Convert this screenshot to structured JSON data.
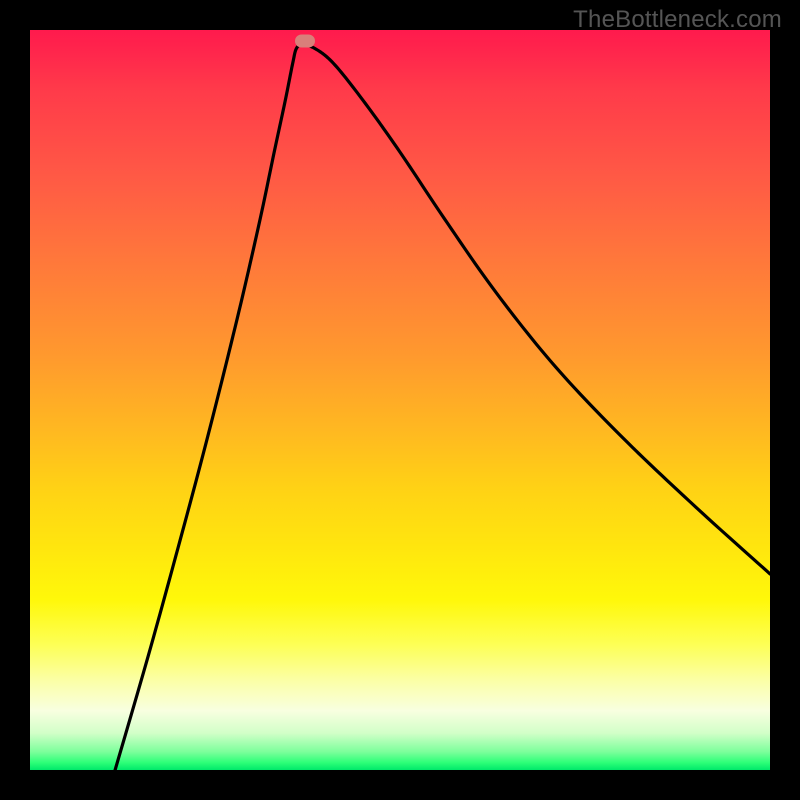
{
  "watermark": "TheBottleneck.com",
  "colors": {
    "curve_stroke": "#000000",
    "marker_fill": "#d97f7a",
    "frame_bg": "#000000"
  },
  "chart_data": {
    "type": "line",
    "title": "",
    "xlabel": "",
    "ylabel": "",
    "xlim": [
      0,
      1
    ],
    "ylim": [
      0,
      1
    ],
    "trough_x": 0.368,
    "trough_y": 0.98,
    "left_start_x": 0.115,
    "right_end_y": 0.265,
    "series": [
      {
        "name": "bottleneck-curve",
        "x": [
          0.115,
          0.16,
          0.2,
          0.24,
          0.28,
          0.31,
          0.33,
          0.345,
          0.355,
          0.36,
          0.368,
          0.385,
          0.41,
          0.45,
          0.5,
          0.56,
          0.63,
          0.71,
          0.8,
          0.9,
          1.0
        ],
        "y": [
          0.0,
          0.155,
          0.3,
          0.45,
          0.61,
          0.74,
          0.835,
          0.905,
          0.955,
          0.975,
          0.98,
          0.975,
          0.955,
          0.905,
          0.835,
          0.745,
          0.645,
          0.545,
          0.45,
          0.355,
          0.265
        ]
      }
    ],
    "marker": {
      "x": 0.371,
      "y": 0.985,
      "radius": 0.014
    }
  }
}
